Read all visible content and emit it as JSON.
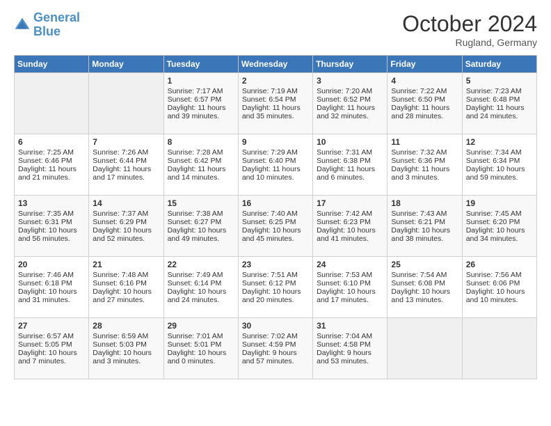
{
  "logo": {
    "line1": "General",
    "line2": "Blue"
  },
  "title": "October 2024",
  "location": "Rugland, Germany",
  "weekdays": [
    "Sunday",
    "Monday",
    "Tuesday",
    "Wednesday",
    "Thursday",
    "Friday",
    "Saturday"
  ],
  "weeks": [
    [
      {
        "day": "",
        "empty": true
      },
      {
        "day": "",
        "empty": true
      },
      {
        "day": "1",
        "sunrise": "Sunrise: 7:17 AM",
        "sunset": "Sunset: 6:57 PM",
        "daylight": "Daylight: 11 hours and 39 minutes."
      },
      {
        "day": "2",
        "sunrise": "Sunrise: 7:19 AM",
        "sunset": "Sunset: 6:54 PM",
        "daylight": "Daylight: 11 hours and 35 minutes."
      },
      {
        "day": "3",
        "sunrise": "Sunrise: 7:20 AM",
        "sunset": "Sunset: 6:52 PM",
        "daylight": "Daylight: 11 hours and 32 minutes."
      },
      {
        "day": "4",
        "sunrise": "Sunrise: 7:22 AM",
        "sunset": "Sunset: 6:50 PM",
        "daylight": "Daylight: 11 hours and 28 minutes."
      },
      {
        "day": "5",
        "sunrise": "Sunrise: 7:23 AM",
        "sunset": "Sunset: 6:48 PM",
        "daylight": "Daylight: 11 hours and 24 minutes."
      }
    ],
    [
      {
        "day": "6",
        "sunrise": "Sunrise: 7:25 AM",
        "sunset": "Sunset: 6:46 PM",
        "daylight": "Daylight: 11 hours and 21 minutes."
      },
      {
        "day": "7",
        "sunrise": "Sunrise: 7:26 AM",
        "sunset": "Sunset: 6:44 PM",
        "daylight": "Daylight: 11 hours and 17 minutes."
      },
      {
        "day": "8",
        "sunrise": "Sunrise: 7:28 AM",
        "sunset": "Sunset: 6:42 PM",
        "daylight": "Daylight: 11 hours and 14 minutes."
      },
      {
        "day": "9",
        "sunrise": "Sunrise: 7:29 AM",
        "sunset": "Sunset: 6:40 PM",
        "daylight": "Daylight: 11 hours and 10 minutes."
      },
      {
        "day": "10",
        "sunrise": "Sunrise: 7:31 AM",
        "sunset": "Sunset: 6:38 PM",
        "daylight": "Daylight: 11 hours and 6 minutes."
      },
      {
        "day": "11",
        "sunrise": "Sunrise: 7:32 AM",
        "sunset": "Sunset: 6:36 PM",
        "daylight": "Daylight: 11 hours and 3 minutes."
      },
      {
        "day": "12",
        "sunrise": "Sunrise: 7:34 AM",
        "sunset": "Sunset: 6:34 PM",
        "daylight": "Daylight: 10 hours and 59 minutes."
      }
    ],
    [
      {
        "day": "13",
        "sunrise": "Sunrise: 7:35 AM",
        "sunset": "Sunset: 6:31 PM",
        "daylight": "Daylight: 10 hours and 56 minutes."
      },
      {
        "day": "14",
        "sunrise": "Sunrise: 7:37 AM",
        "sunset": "Sunset: 6:29 PM",
        "daylight": "Daylight: 10 hours and 52 minutes."
      },
      {
        "day": "15",
        "sunrise": "Sunrise: 7:38 AM",
        "sunset": "Sunset: 6:27 PM",
        "daylight": "Daylight: 10 hours and 49 minutes."
      },
      {
        "day": "16",
        "sunrise": "Sunrise: 7:40 AM",
        "sunset": "Sunset: 6:25 PM",
        "daylight": "Daylight: 10 hours and 45 minutes."
      },
      {
        "day": "17",
        "sunrise": "Sunrise: 7:42 AM",
        "sunset": "Sunset: 6:23 PM",
        "daylight": "Daylight: 10 hours and 41 minutes."
      },
      {
        "day": "18",
        "sunrise": "Sunrise: 7:43 AM",
        "sunset": "Sunset: 6:21 PM",
        "daylight": "Daylight: 10 hours and 38 minutes."
      },
      {
        "day": "19",
        "sunrise": "Sunrise: 7:45 AM",
        "sunset": "Sunset: 6:20 PM",
        "daylight": "Daylight: 10 hours and 34 minutes."
      }
    ],
    [
      {
        "day": "20",
        "sunrise": "Sunrise: 7:46 AM",
        "sunset": "Sunset: 6:18 PM",
        "daylight": "Daylight: 10 hours and 31 minutes."
      },
      {
        "day": "21",
        "sunrise": "Sunrise: 7:48 AM",
        "sunset": "Sunset: 6:16 PM",
        "daylight": "Daylight: 10 hours and 27 minutes."
      },
      {
        "day": "22",
        "sunrise": "Sunrise: 7:49 AM",
        "sunset": "Sunset: 6:14 PM",
        "daylight": "Daylight: 10 hours and 24 minutes."
      },
      {
        "day": "23",
        "sunrise": "Sunrise: 7:51 AM",
        "sunset": "Sunset: 6:12 PM",
        "daylight": "Daylight: 10 hours and 20 minutes."
      },
      {
        "day": "24",
        "sunrise": "Sunrise: 7:53 AM",
        "sunset": "Sunset: 6:10 PM",
        "daylight": "Daylight: 10 hours and 17 minutes."
      },
      {
        "day": "25",
        "sunrise": "Sunrise: 7:54 AM",
        "sunset": "Sunset: 6:08 PM",
        "daylight": "Daylight: 10 hours and 13 minutes."
      },
      {
        "day": "26",
        "sunrise": "Sunrise: 7:56 AM",
        "sunset": "Sunset: 6:06 PM",
        "daylight": "Daylight: 10 hours and 10 minutes."
      }
    ],
    [
      {
        "day": "27",
        "sunrise": "Sunrise: 6:57 AM",
        "sunset": "Sunset: 5:05 PM",
        "daylight": "Daylight: 10 hours and 7 minutes."
      },
      {
        "day": "28",
        "sunrise": "Sunrise: 6:59 AM",
        "sunset": "Sunset: 5:03 PM",
        "daylight": "Daylight: 10 hours and 3 minutes."
      },
      {
        "day": "29",
        "sunrise": "Sunrise: 7:01 AM",
        "sunset": "Sunset: 5:01 PM",
        "daylight": "Daylight: 10 hours and 0 minutes."
      },
      {
        "day": "30",
        "sunrise": "Sunrise: 7:02 AM",
        "sunset": "Sunset: 4:59 PM",
        "daylight": "Daylight: 9 hours and 57 minutes."
      },
      {
        "day": "31",
        "sunrise": "Sunrise: 7:04 AM",
        "sunset": "Sunset: 4:58 PM",
        "daylight": "Daylight: 9 hours and 53 minutes."
      },
      {
        "day": "",
        "empty": true
      },
      {
        "day": "",
        "empty": true
      }
    ]
  ]
}
